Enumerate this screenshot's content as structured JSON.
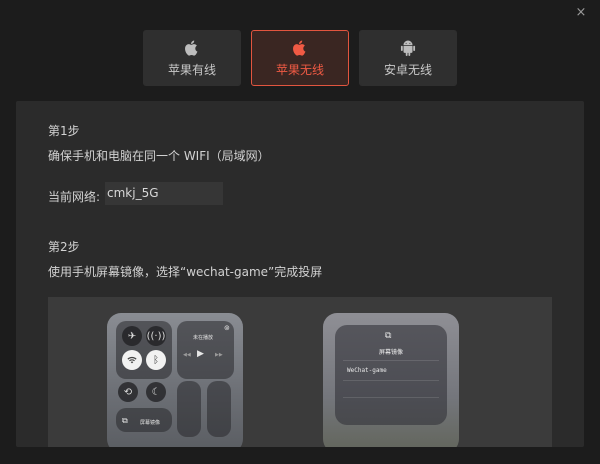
{
  "close_label": "×",
  "tabs": [
    {
      "label": "苹果有线",
      "icon": "apple-icon",
      "active": false
    },
    {
      "label": "苹果无线",
      "icon": "apple-icon",
      "active": true
    },
    {
      "label": "安卓无线",
      "icon": "android-icon",
      "active": false
    }
  ],
  "step1": {
    "title": "第1步",
    "desc": "确保手机和电脑在同一个 WIFI（局域网）",
    "network_label": "当前网络:",
    "network_value": "cmkj_5G"
  },
  "step2": {
    "title": "第2步",
    "desc": "使用手机屏幕镜像，选择“wechat-game”完成投屏"
  },
  "illustration": {
    "now_playing": "未在播放",
    "mirror_label": "屏幕镜像",
    "mirror_title": "屏幕镜像",
    "mirror_item": "WeChat-game"
  },
  "colors": {
    "accent": "#f05a44",
    "background": "#1c1c1c",
    "panel": "#2b2b2b"
  }
}
